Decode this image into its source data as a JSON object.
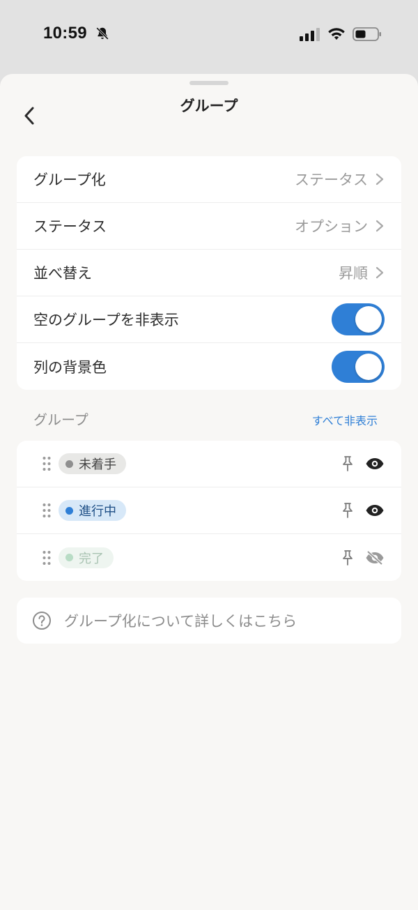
{
  "status_bar": {
    "time": "10:59",
    "icons": [
      "bell-slash-icon",
      "signal-icon",
      "wifi-icon",
      "battery-icon"
    ]
  },
  "header": {
    "title": "グループ",
    "back_icon": "chevron-left-icon"
  },
  "settings": {
    "group_by": {
      "label": "グループ化",
      "value": "ステータス"
    },
    "status": {
      "label": "ステータス",
      "value": "オプション"
    },
    "sort": {
      "label": "並べ替え",
      "value": "昇順"
    },
    "hide_empty": {
      "label": "空のグループを非表示",
      "on": true
    },
    "column_bg": {
      "label": "列の背景色",
      "on": true
    }
  },
  "groups_section": {
    "title": "グループ",
    "hide_all_label": "すべて非表示",
    "items": [
      {
        "label": "未着手",
        "dot_color": "#8f8f8f",
        "pill_bg": "#e8e8e6",
        "text_color": "#444444",
        "visible": true
      },
      {
        "label": "進行中",
        "dot_color": "#2f7fd6",
        "pill_bg": "#d7e8f8",
        "text_color": "#1f4f86",
        "visible": true
      },
      {
        "label": "完了",
        "dot_color": "#b8dcc5",
        "pill_bg": "#eef5f0",
        "text_color": "#a9c3b2",
        "visible": false
      }
    ]
  },
  "help": {
    "text": "グループ化について詳しくはこちら",
    "icon": "question-circle-icon"
  },
  "colors": {
    "accent": "#2f7fd6",
    "sheet_bg": "#f8f7f5",
    "card_bg": "#ffffff"
  }
}
